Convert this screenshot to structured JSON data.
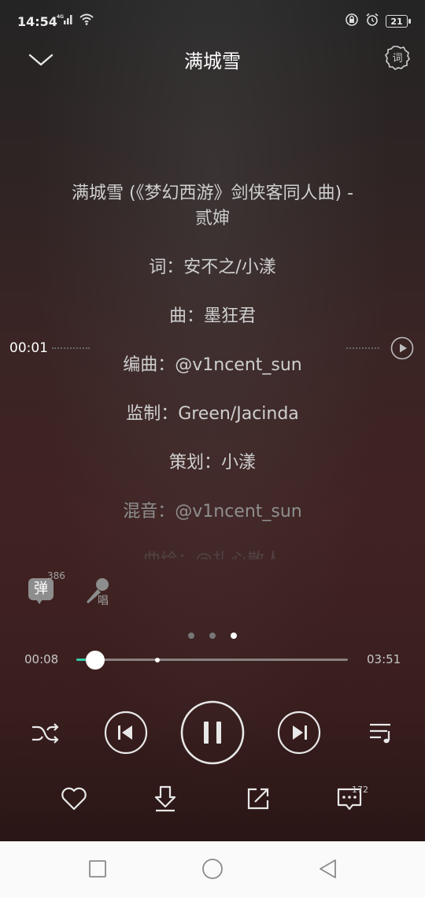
{
  "status_bar": {
    "time": "14:54",
    "network": "4G",
    "battery": "21"
  },
  "header": {
    "title": "满城雪",
    "lyric_button_label": "词"
  },
  "lyrics": {
    "title_line1": "满城雪 (《梦幻西游》剑侠客同人曲) -",
    "title_line2": "贰婶",
    "lines": [
      "词：安不之/小漾",
      "曲：墨狂君",
      "编曲：@v1ncent_sun",
      "监制：Green/Jacinda",
      "策划：小漾",
      "混音：@v1ncent_sun",
      "曲绘：@扎心散人"
    ]
  },
  "seek_overlay": {
    "time": "00:01"
  },
  "extras": {
    "danmu_label": "弹",
    "danmu_count": "386",
    "sing_label": "唱"
  },
  "page_indicator": {
    "count": 3,
    "active_index": 2
  },
  "playback": {
    "elapsed": "00:08",
    "total": "03:51",
    "progress_fraction": 0.035,
    "buffered_fraction": 0.3,
    "state": "playing"
  },
  "actions": {
    "comment_count": "172"
  },
  "colors": {
    "accent": "#33ccaa",
    "icon": "#e8e8e8"
  }
}
